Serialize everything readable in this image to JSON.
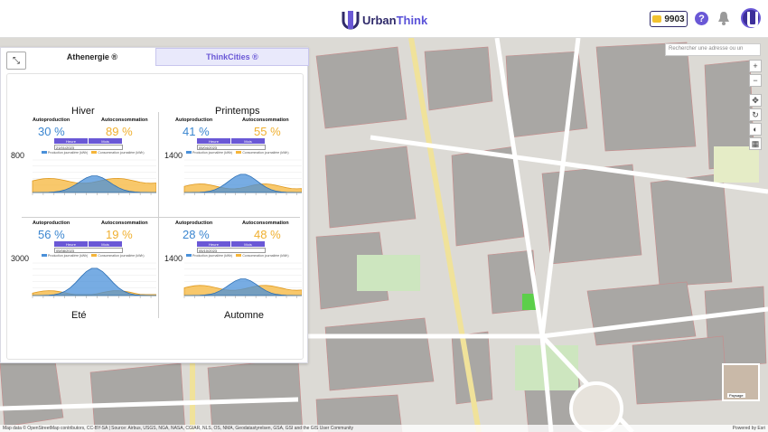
{
  "header": {
    "brand_prefix": "Urban",
    "brand_suffix": "Think",
    "credits": "9903",
    "help_symbol": "?"
  },
  "map": {
    "search_placeholder": "Rechercher une adresse ou un",
    "tools": [
      "+",
      "−",
      "✥",
      "↻",
      "◐",
      "▦"
    ],
    "minimap_label": "Paysage",
    "attribution": "Map data © OpenStreetMap contributors, CC-BY-SA | Source: Airbus, USGS, NGA, NASA, CGIAR, NLS, OS, NMA, Geodatastyrelsen, GSA, GSI and the GIS User Community",
    "powered": "Powered by Esri"
  },
  "panel": {
    "tab_active": "Athenergie ®",
    "tab_inactive": "ThinkCities ®",
    "collapse_icon": "⤡",
    "labels": {
      "auto_prod": "Autoproduction",
      "auto_cons": "Autoconsommation",
      "hour": "Heure",
      "month": "Mois"
    },
    "legend_prod": "Production journalière (kWh)",
    "legend_cons": "Consommation journalière (kWh)",
    "seasons": [
      {
        "id": "hiver",
        "title": "Hiver",
        "prod_pct": "30 %",
        "cons_pct": "89 %",
        "date": "21/01/2023",
        "ymax": "800",
        "prod_peak": 0.55,
        "cons_level": 0.38
      },
      {
        "id": "printemps",
        "title": "Printemps",
        "prod_pct": "41 %",
        "cons_pct": "55 %",
        "date": "05/04/2023",
        "ymax": "1400",
        "prod_peak": 0.6,
        "cons_level": 0.2
      },
      {
        "id": "ete",
        "title": "Eté",
        "prod_pct": "56 %",
        "cons_pct": "19 %",
        "date": "05/08/2023",
        "ymax": "3000",
        "prod_peak": 0.9,
        "cons_level": 0.08
      },
      {
        "id": "automne",
        "title": "Automne",
        "prod_pct": "28 %",
        "cons_pct": "48 %",
        "date": "05/10/2023",
        "ymax": "1400",
        "prod_peak": 0.55,
        "cons_level": 0.25
      }
    ]
  },
  "colors": {
    "accent": "#6a58d6",
    "prod": "#4a90d9",
    "cons": "#f5b53a",
    "brand_dark": "#2f2a6a"
  }
}
